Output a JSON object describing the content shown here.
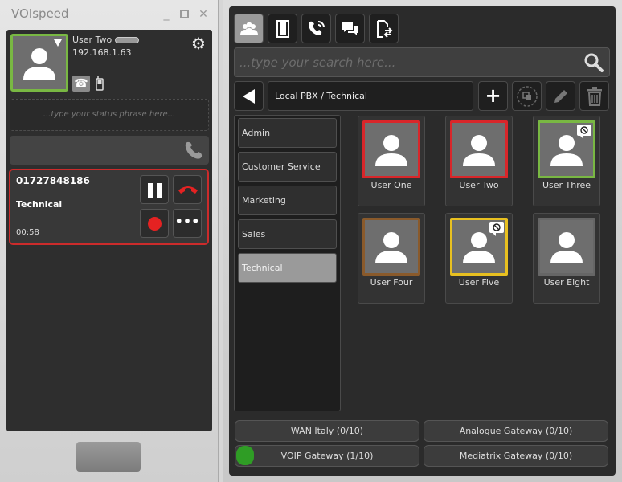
{
  "app": {
    "title": "VOIspeed"
  },
  "profile": {
    "name": "User Two",
    "ip": "192.168.1.63",
    "avatar_border_color": "#79b843",
    "status_placeholder": "...type your status phrase here..."
  },
  "call": {
    "number": "01727848186",
    "group": "Technical",
    "timer": "00:58",
    "more_label": "•••",
    "border_color": "#cc2b2b"
  },
  "toolbar": {
    "tabs": [
      {
        "name": "contacts",
        "icon": "contacts-icon",
        "active": true
      },
      {
        "name": "phonebook",
        "icon": "phonebook-icon",
        "active": false
      },
      {
        "name": "call-history",
        "icon": "call-history-icon",
        "active": false
      },
      {
        "name": "chat",
        "icon": "chat-icon",
        "active": false
      },
      {
        "name": "transfer",
        "icon": "transfer-icon",
        "active": false
      }
    ]
  },
  "search": {
    "placeholder": "...type your search here..."
  },
  "breadcrumb": "Local PBX / Technical",
  "actions": {
    "add_label": "+"
  },
  "groups": [
    {
      "label": "Admin",
      "selected": false
    },
    {
      "label": "Customer Service",
      "selected": false
    },
    {
      "label": "Marketing",
      "selected": false
    },
    {
      "label": "Sales",
      "selected": false
    },
    {
      "label": "Technical",
      "selected": true
    }
  ],
  "contacts": [
    {
      "name": "User One",
      "status_color": "#d9262a",
      "dnd": false
    },
    {
      "name": "User Two",
      "status_color": "#d9262a",
      "dnd": false
    },
    {
      "name": "User Three",
      "status_color": "#79b843",
      "dnd": true
    },
    {
      "name": "User Four",
      "status_color": "#8a5a2b",
      "dnd": false
    },
    {
      "name": "User Five",
      "status_color": "#e8c020",
      "dnd": true
    },
    {
      "name": "User Eight",
      "status_color": "#666666",
      "dnd": false
    }
  ],
  "gateways": [
    {
      "label": "WAN Italy (0/10)"
    },
    {
      "label": "Analogue Gateway (0/10)"
    },
    {
      "label": "VOIP Gateway (1/10)"
    },
    {
      "label": "Mediatrix Gateway (0/10)"
    }
  ]
}
